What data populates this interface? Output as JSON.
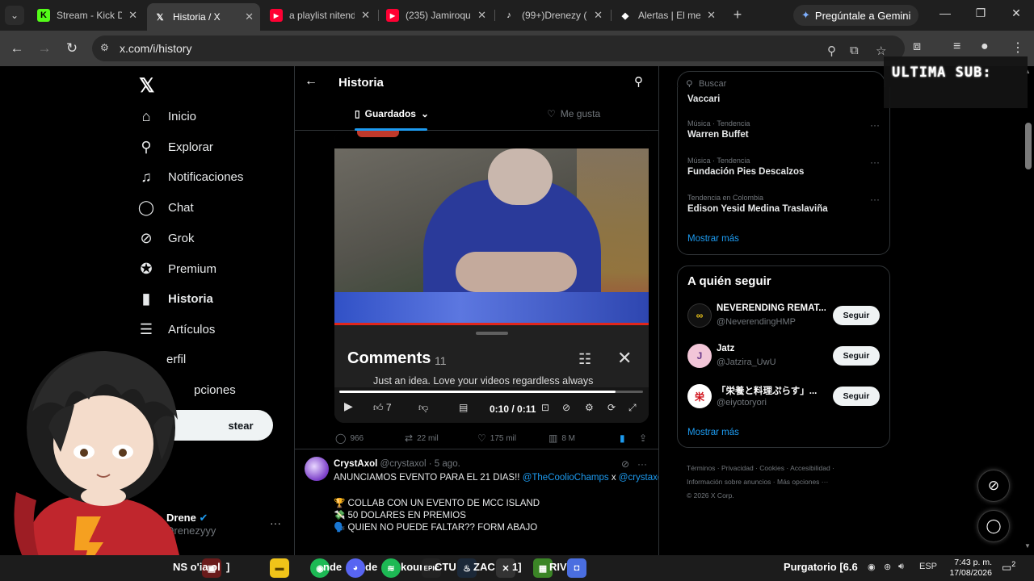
{
  "browser": {
    "tabs": [
      {
        "title": "Stream - Kick D",
        "icon": "kick-icon",
        "color": "#53fc18",
        "active": false
      },
      {
        "title": "Historia / X",
        "icon": "x-icon",
        "color": "#ffffff",
        "active": true
      },
      {
        "title": "a playlist nitend",
        "icon": "youtube-icon",
        "color": "#ff0033",
        "active": false
      },
      {
        "title": "(235) Jamiroqu",
        "icon": "youtube-icon",
        "color": "#ff0033",
        "active": false
      },
      {
        "title": "(99+)Drenezy (",
        "icon": "tiktok-icon",
        "color": "#ffffff",
        "active": false
      },
      {
        "title": "Alertas | El mej",
        "icon": "alert-icon",
        "color": "#ffffff",
        "active": false
      }
    ],
    "gemini_label": "Pregúntale a Gemini",
    "url": "x.com/i/history"
  },
  "sidebar": {
    "items": [
      {
        "label": "Inicio",
        "icon": "home-icon",
        "glyph": "⌂"
      },
      {
        "label": "Explorar",
        "icon": "search-icon",
        "glyph": "⚲"
      },
      {
        "label": "Notificaciones",
        "icon": "bell-icon",
        "glyph": "🔔︎"
      },
      {
        "label": "Chat",
        "icon": "chat-icon",
        "glyph": "◯"
      },
      {
        "label": "Grok",
        "icon": "grok-icon",
        "glyph": "⊘"
      },
      {
        "label": "Premium",
        "icon": "premium-icon",
        "glyph": "✪"
      },
      {
        "label": "Historia",
        "icon": "bookmark-icon",
        "glyph": "▮"
      },
      {
        "label": "Artículos",
        "icon": "articles-icon",
        "glyph": "☰"
      },
      {
        "label": "erfil",
        "icon": "profile-icon",
        "glyph": ""
      },
      {
        "label": "pciones",
        "icon": "more-icon",
        "glyph": ""
      }
    ],
    "post_label": "stear",
    "account_name": "Drene",
    "account_handle": "Drenezyyy"
  },
  "main": {
    "title": "Historia",
    "tabs": [
      {
        "label": "Guardados",
        "active": true
      },
      {
        "label": "Me gusta",
        "active": false
      }
    ],
    "video": {
      "comments_title": "Comments",
      "comments_count": "11",
      "comment_preview": "Just an idea. Love your videos regardless always",
      "time": "0:10 / 0:11",
      "progress": 0.91
    },
    "actions": {
      "replies": "966",
      "reposts": "22 mil",
      "likes": "175 mil",
      "views": "8 M"
    },
    "tweet": {
      "name": "CrystAxol",
      "handle": "@crystaxol",
      "date": "· 5 ago.",
      "line1_text": "ANUNCIAMOS EVENTO PARA EL 21 DIAS!! ",
      "line1_mention1": "@TheCoolioChamps",
      "line1_x": " x ",
      "line1_mention2": "@crystaxol",
      "line2": "🏆 COLLAB CON UN EVENTO DE MCC ISLAND",
      "line3": "💸 50 DOLARES EN PREMIOS",
      "line4": "🗣️ QUIEN NO PUEDE FALTAR?? FORM ABAJO"
    }
  },
  "right": {
    "search_placeholder": "Buscar",
    "partial_trend": "Vaccari",
    "trends": [
      {
        "context": "Música · Tendencia",
        "title": "Warren Buffet"
      },
      {
        "context": "Música · Tendencia",
        "title": "Fundación Pies Descalzos"
      },
      {
        "context": "Tendencia en Colombia",
        "title": "Edison Yesid Medina Traslaviña"
      }
    ],
    "show_more": "Mostrar más",
    "who_to_follow_title": "A quién seguir",
    "who_to_follow": [
      {
        "name": "NEVERENDING REMAT...",
        "handle": "@NeverendingHMP",
        "avatar_color": "#111111",
        "avatar_fg": "#e8c21a",
        "avatar_glyph": "∞"
      },
      {
        "name": "Jatz",
        "handle": "@Jatzira_UwU",
        "avatar_color": "#f2c6d8",
        "avatar_fg": "#6a3a8a",
        "avatar_glyph": "J"
      },
      {
        "name": "「栄養と料理ぷらす」...",
        "handle": "@eiyotoryori",
        "avatar_color": "#ffffff",
        "avatar_fg": "#d0121b",
        "avatar_glyph": "栄"
      }
    ],
    "follow_label": "Seguir",
    "footer": [
      "Términos",
      "Privacidad",
      "Cookies",
      "Accesibilidad",
      "Información sobre anuncios",
      "Más opciones ···",
      "© 2026 X Corp."
    ]
  },
  "overlay": {
    "sub_text": "ULTIMA SUB:"
  },
  "taskbar": {
    "window_label_1": "NS o'ia ol",
    "window_label_2": "nde",
    "window_label_3": "de",
    "window_label_4": "kour",
    "window_label_5": "CTU",
    "window_label_6": "ZAC",
    "window_label_7": "RIV",
    "tray_label": "Purgatorio [6.6",
    "lang": "ESP",
    "time": "7:43 p. m.",
    "date": "17/08/2026",
    "notifications": "2"
  }
}
